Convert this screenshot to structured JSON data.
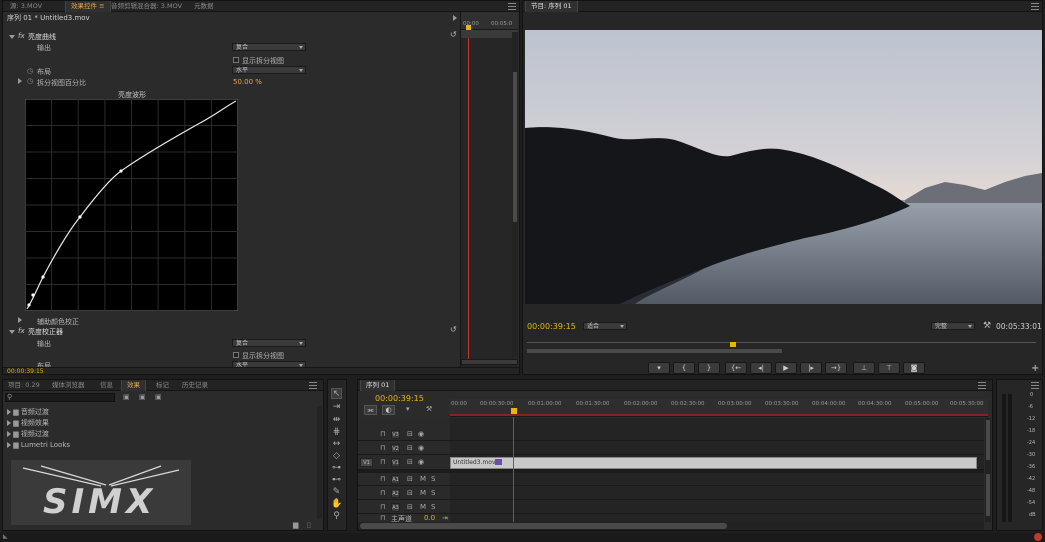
{
  "effect_controls": {
    "tabs": [
      "源: 3.MOV",
      "效果控件 ≡",
      "音频剪辑混合器: 3.MOV",
      "元数据"
    ],
    "seq_label": "序列 01 * Untitled3.mov",
    "mini_time": [
      "00:00",
      "00:05:0"
    ],
    "section1": {
      "name": "亮度曲线",
      "output_label": "输出",
      "output_value": "复合",
      "split_view_label": "显示拆分视图",
      "layout_label": "布局",
      "layout_value": "水平",
      "split_pct_label": "拆分视图百分比",
      "split_pct_value": "50.00 %",
      "graph_title": "亮度波形"
    },
    "aux_label": "辅助颜色校正",
    "section2": {
      "name": "亮度校正器",
      "output_label": "输出",
      "output_value": "复合",
      "split_view_label": "显示拆分视图",
      "layout_label": "布局",
      "layout_value": "水平"
    },
    "bottom_time": "00:00:39:15",
    "fx_symbol": "fx"
  },
  "program": {
    "tab": "节目: 序列 01",
    "timecode": "00:00:39:15",
    "fit": "适合",
    "quality": "完整",
    "duration": "00:05:33:01"
  },
  "project": {
    "tabs": [
      "项目: 0.29",
      "媒体浏览器",
      "信息",
      "效果",
      "标记",
      "历史记录"
    ],
    "folders": [
      "音频过渡",
      "视频效果",
      "视频过渡",
      "Lumetri Looks"
    ],
    "logo_text": "SIMX"
  },
  "timeline": {
    "tab": "序列 01",
    "timecode": "00:00:39:15",
    "ruler": [
      "00:00",
      "00:00:30:00",
      "00:01:00:00",
      "00:01:30:00",
      "00:02:00:00",
      "00:02:30:00",
      "00:03:00:00",
      "00:03:30:00",
      "00:04:00:00",
      "00:04:30:00",
      "00:05:00:00",
      "00:05:30:00"
    ],
    "video_tracks": [
      "V3",
      "V2",
      "V1"
    ],
    "audio_tracks": [
      "A1",
      "A2",
      "A3"
    ],
    "source_patch": "V1",
    "master_label": "主声道",
    "master_value": "0.0",
    "clip_name": "Untitled3.mov"
  },
  "meter": {
    "scale": [
      "0",
      "-6",
      "-12",
      "-18",
      "-24",
      "-30",
      "-36",
      "-42",
      "-48",
      "-54",
      "dB"
    ]
  },
  "colors": {
    "accent": "#e6b800",
    "playhead": "#c0392b",
    "clip": "#c9c9c9"
  },
  "icons": [
    "menu-icon",
    "close-icon",
    "reset-icon",
    "wrench-icon",
    "play-icon",
    "step-back-icon",
    "step-forward-icon",
    "mark-in-icon",
    "mark-out-icon",
    "marker-icon",
    "camera-icon",
    "folder-icon",
    "lock-icon",
    "eye-icon",
    "selection-tool-icon",
    "razor-tool-icon",
    "hand-tool-icon",
    "zoom-tool-icon",
    "pen-tool-icon"
  ]
}
